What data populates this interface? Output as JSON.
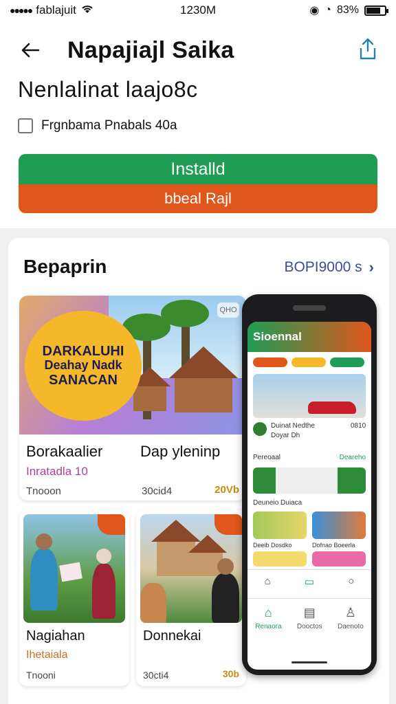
{
  "status_bar": {
    "carrier": "fablajuit",
    "time": "1230M",
    "battery": "83%"
  },
  "header": {
    "title": "Napajiajl Saika",
    "back_icon": "arrow-left-icon",
    "share_icon": "share-icon"
  },
  "subtitle": "Nenlalinat laajo8c",
  "checkbox": {
    "label": "Frgnbama Pnabals 40a",
    "checked": false
  },
  "buttons": {
    "install": "Installd",
    "secondary": "bbeal Rajl"
  },
  "colors": {
    "green": "#1f9d55",
    "orange": "#e0561b",
    "link": "#3d4a9c"
  },
  "section": {
    "title": "Bepaprin",
    "see_all": "BOPI9000 s"
  },
  "featured": {
    "badge_line1": "DARKALUHI",
    "badge_line2": "Deahay Nadk",
    "badge_line3": "SANACAN",
    "corner": "QHO",
    "caption_left": "Borakaalier",
    "caption_right": "Dap yleninp",
    "category": "Inratadla 10",
    "meta_left": "Tnooon",
    "meta_right": "30cid4",
    "rating": "20Vb"
  },
  "tiles": [
    {
      "title": "Nagiahan",
      "category": "Ihetaiala",
      "meta": "Tnooni",
      "rating": ""
    },
    {
      "title": "Donnekai",
      "category": "",
      "meta": "30cti4",
      "rating": "30b"
    }
  ],
  "phone": {
    "header": "Sioennal",
    "line1": "Duinat Nedthe",
    "line2": "Doyar Dh",
    "corner": "0810",
    "section1": "Pereoaal",
    "more": "Deareho",
    "section2": "Deuneio Duiaca",
    "cap1": "Deeib Dosdko",
    "cap2": "Dofnao Boeerla",
    "tabs": [
      "Renaora",
      "Dooctos",
      "Daenoto"
    ]
  }
}
